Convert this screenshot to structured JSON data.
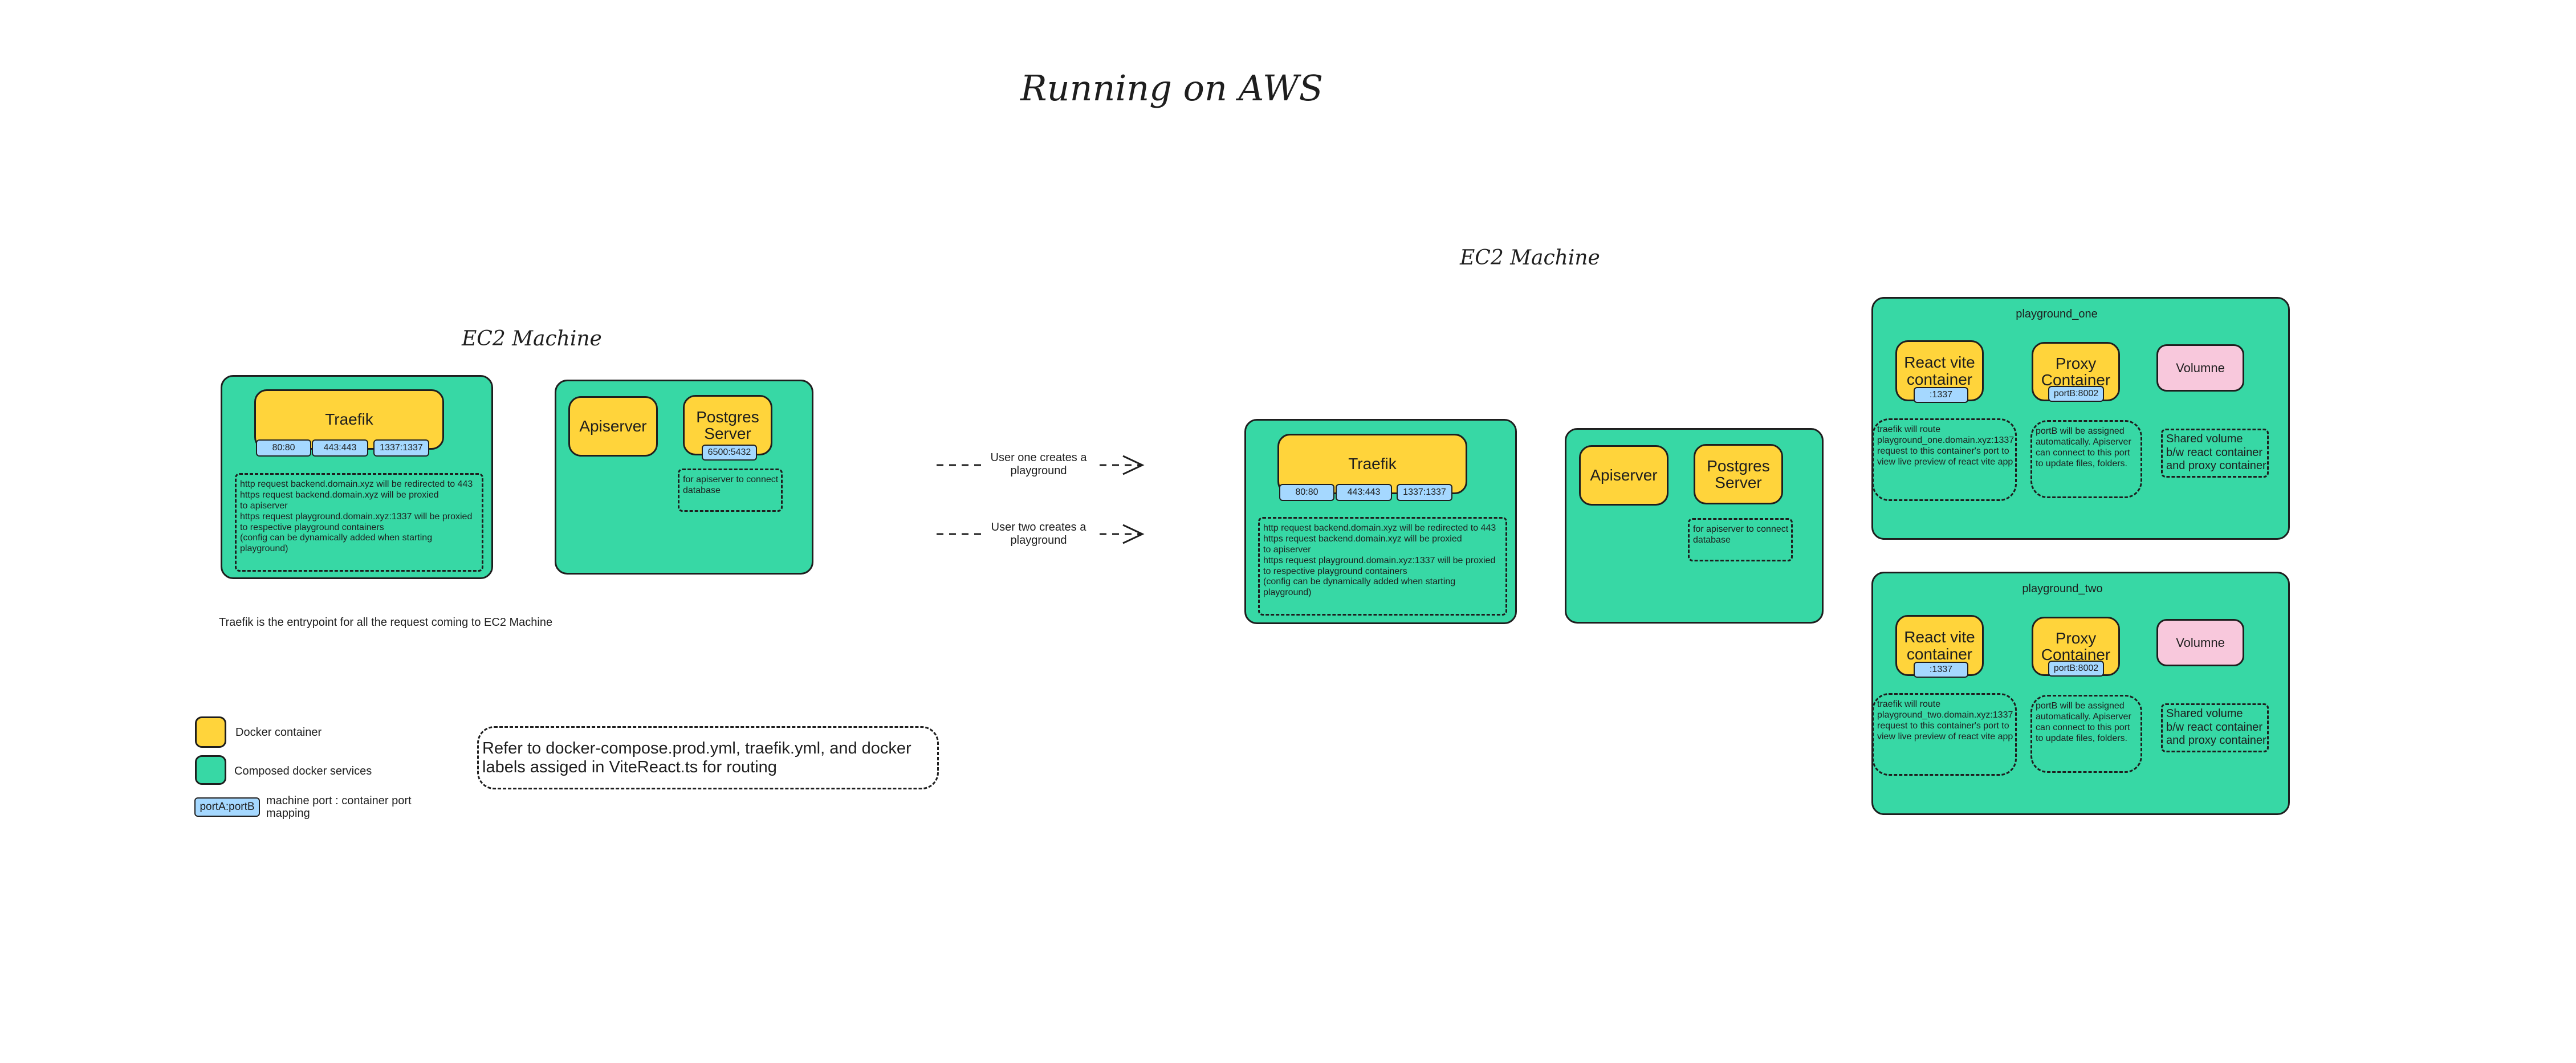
{
  "title": "Running on AWS",
  "left_machine": {
    "label": "EC2 Machine",
    "traefik": "Traefik",
    "ports": [
      "80:80",
      "443:443",
      "1337:1337"
    ],
    "traefik_note": [
      "http request backend.domain.xyz will be redirected to 443",
      "https request backend.domain.xyz will be proxied",
      " to apiserver",
      "https request playground.domain.xyz:1337 will be proxied",
      "to respective playground containers",
      "(config can be dynamically added when starting",
      "playground)"
    ],
    "apiserver": "Apiserver",
    "postgres": "Postgres\nServer",
    "postgres_port": "6500:5432",
    "postgres_note": [
      "for apiserver to connect",
      "database"
    ],
    "entry_note": "Traefik is the entrypoint for all the request coming to EC2 Machine"
  },
  "arrows": {
    "user_one": "User one creates a\nplayground",
    "user_two": "User two creates a\nplayground"
  },
  "right_machine": {
    "label": "EC2 Machine",
    "traefik": "Traefik",
    "ports": [
      "80:80",
      "443:443",
      "1337:1337"
    ],
    "traefik_note": [
      "http request backend.domain.xyz will be redirected to 443",
      "https request backend.domain.xyz will be proxied",
      " to apiserver",
      "https request playground.domain.xyz:1337 will be proxied",
      "to respective playground containers",
      "(config can be dynamically added when starting",
      "playground)"
    ],
    "apiserver": "Apiserver",
    "postgres": "Postgres\nServer",
    "postgres_note": [
      "for apiserver to connect",
      "database"
    ]
  },
  "playground_one": {
    "name": "playground_one",
    "react": "React vite\ncontainer",
    "react_port": ":1337",
    "proxy": "Proxy\nContainer",
    "proxy_port": "portB:8002",
    "volume": "Volumne",
    "react_note": [
      "traefik will route",
      "playground_one.domain.xyz:1337",
      "request to this container's port to",
      "view live preview of react vite app"
    ],
    "proxy_note": [
      "portB will be assigned",
      "automatically. Apiserver",
      "can connect to this port",
      "to update files, folders."
    ],
    "volume_note": [
      "Shared volume",
      "b/w react container",
      "and proxy container"
    ]
  },
  "playground_two": {
    "name": "playground_two",
    "react": "React vite\ncontainer",
    "react_port": ":1337",
    "proxy": "Proxy\nContainer",
    "proxy_port": "portB:8002",
    "volume": "Volumne",
    "react_note": [
      "traefik will route",
      "playground_two.domain.xyz:1337",
      "request to this container's port to",
      "view live preview of react vite app"
    ],
    "proxy_note": [
      "portB will be assigned",
      "automatically. Apiserver",
      "can connect to this port",
      "to update files, folders."
    ],
    "volume_note": [
      "Shared volume",
      "b/w react container",
      "and proxy container"
    ]
  },
  "legend": {
    "docker_container": "Docker container",
    "composed_services": "Composed docker services",
    "port_sample": "portA:portB",
    "port_mapping": "machine port : container port\nmapping"
  },
  "reference_note": "Refer to docker-compose.prod.yml, traefik.yml, and docker\nlabels assiged in ViteReact.ts for routing",
  "colors": {
    "container": "#ffd43b",
    "composed": "#37d8a5",
    "port": "#a5d8ff",
    "volume": "#f8c8dc"
  }
}
